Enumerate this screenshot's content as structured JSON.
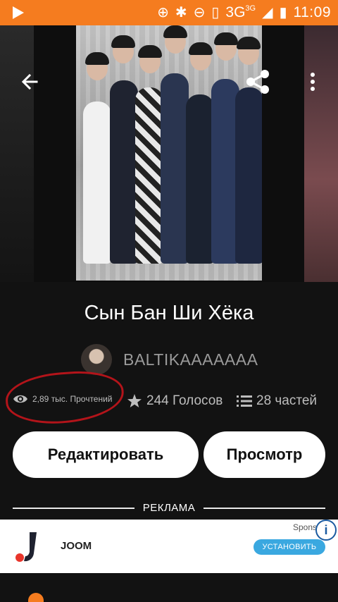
{
  "status_bar": {
    "network": "3G",
    "network_sup": "3G",
    "time": "11:09"
  },
  "story": {
    "title": "Сын Бан Ши Хёка",
    "author": "BALTIKAAAAAAA"
  },
  "stats": {
    "reads": "2,89 тыс. Прочтений",
    "votes": "244 Голосов",
    "parts": "28 частей"
  },
  "actions": {
    "edit_label": "Редактировать",
    "view_label": "Просмотр"
  },
  "ad": {
    "divider_label": "РЕКЛАМА",
    "app_name": "JOOM",
    "sponsored": "Spons",
    "install_label": "УСТАНОВИТЬ"
  },
  "colors": {
    "status_bar": "#f57c1f",
    "background": "#121212",
    "install_button": "#3aa8e0",
    "annotation": "#b3141a"
  }
}
